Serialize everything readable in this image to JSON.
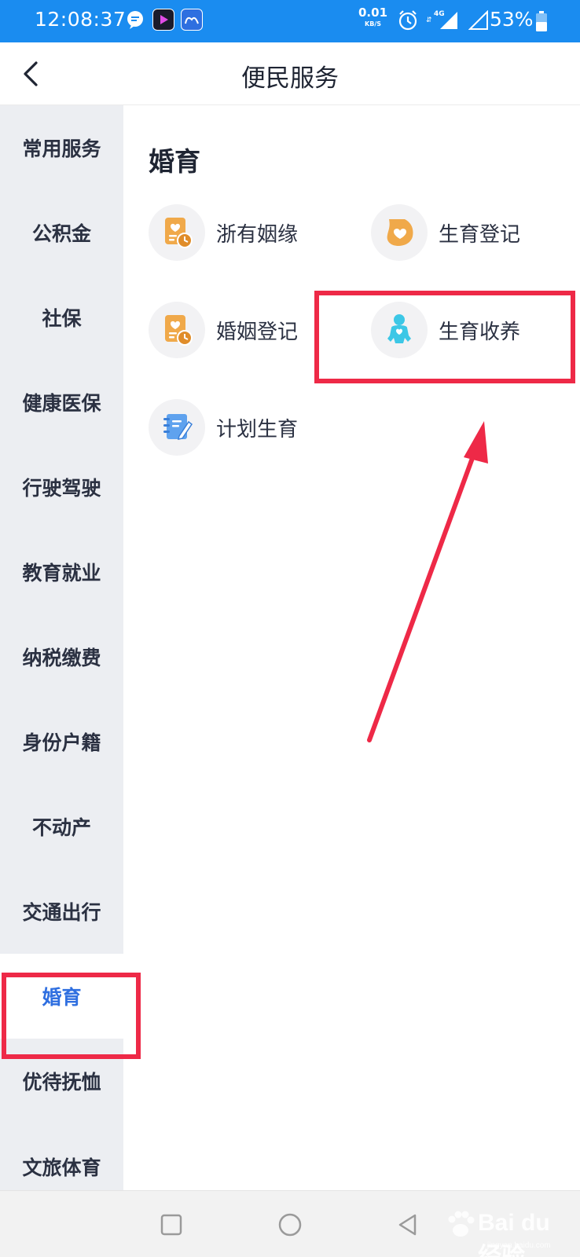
{
  "status_bar": {
    "time": "12:08:37",
    "net_speed_value": "0.01",
    "net_speed_unit": "KB/S",
    "network_type": "4G",
    "battery_percent": "53%"
  },
  "header": {
    "title": "便民服务"
  },
  "sidebar": {
    "items": [
      {
        "label": "常用服务"
      },
      {
        "label": "公积金"
      },
      {
        "label": "社保"
      },
      {
        "label": "健康医保"
      },
      {
        "label": "行驶驾驶"
      },
      {
        "label": "教育就业"
      },
      {
        "label": "纳税缴费"
      },
      {
        "label": "身份户籍"
      },
      {
        "label": "不动产"
      },
      {
        "label": "交通出行"
      },
      {
        "label": "婚育"
      },
      {
        "label": "优待抚恤"
      },
      {
        "label": "文旅体育"
      }
    ],
    "active": "婚育"
  },
  "main": {
    "section_title": "婚育",
    "services": [
      {
        "label": "浙有姻缘",
        "icon": "marriage-document-icon"
      },
      {
        "label": "生育登记",
        "icon": "pregnancy-heart-icon"
      },
      {
        "label": "婚姻登记",
        "icon": "marriage-document-icon"
      },
      {
        "label": "生育收养",
        "icon": "baby-icon"
      },
      {
        "label": "计划生育",
        "icon": "notebook-pen-icon"
      }
    ]
  },
  "watermark": {
    "brand": "Bai du 经验",
    "url": "jingyan.baidu.com"
  },
  "colors": {
    "status_bar": "#1a8cf0",
    "active_tab_text": "#2f6fe0",
    "annotation_red": "#ee2947",
    "sidebar_bg": "#eceef2"
  }
}
